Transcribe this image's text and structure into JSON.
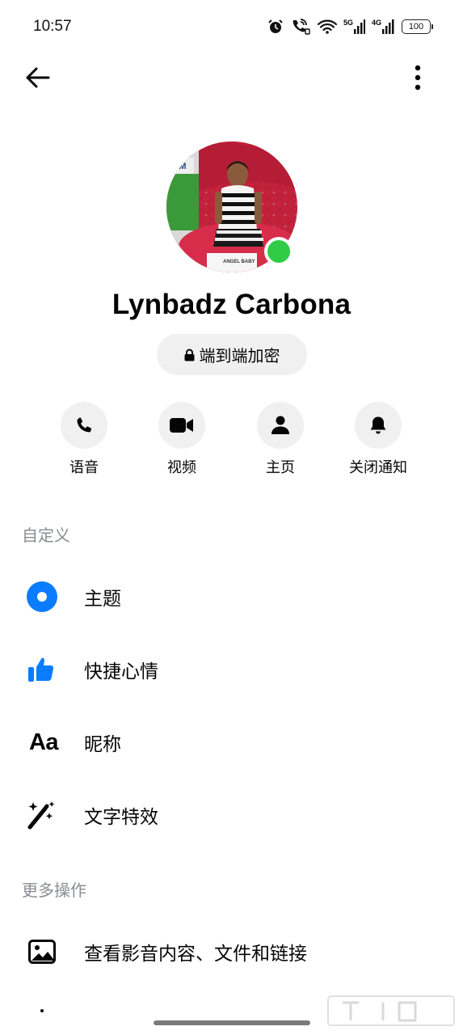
{
  "status_bar": {
    "time": "10:57",
    "net_5g": "5G",
    "net_4g": "4G",
    "battery": "100"
  },
  "profile": {
    "name": "Lynbadz Carbona",
    "online": true,
    "online_color": "#31cc46",
    "encryption_label": "端到端加密"
  },
  "actions": [
    {
      "label": "语音",
      "icon": "phone-icon"
    },
    {
      "label": "视频",
      "icon": "video-camera-icon"
    },
    {
      "label": "主页",
      "icon": "person-icon"
    },
    {
      "label": "关闭通知",
      "icon": "bell-icon"
    }
  ],
  "sections": {
    "customize": {
      "title": "自定义",
      "items": [
        {
          "label": "主题",
          "icon": "theme-circle-icon",
          "color": "#0a7cff"
        },
        {
          "label": "快捷心情",
          "icon": "thumbs-up-icon",
          "color": "#0a7cff"
        },
        {
          "label": "昵称",
          "icon": "text-aa-icon",
          "glyph": "Aa"
        },
        {
          "label": "文字特效",
          "icon": "magic-wand-icon"
        }
      ]
    },
    "more_actions": {
      "title": "更多操作",
      "items": [
        {
          "label": "查看影音内容、文件和链接",
          "icon": "image-gallery-icon"
        }
      ]
    }
  },
  "avatar_image": {
    "sign_text": "ANGEL BABY"
  },
  "accent_color": "#0a7cff"
}
